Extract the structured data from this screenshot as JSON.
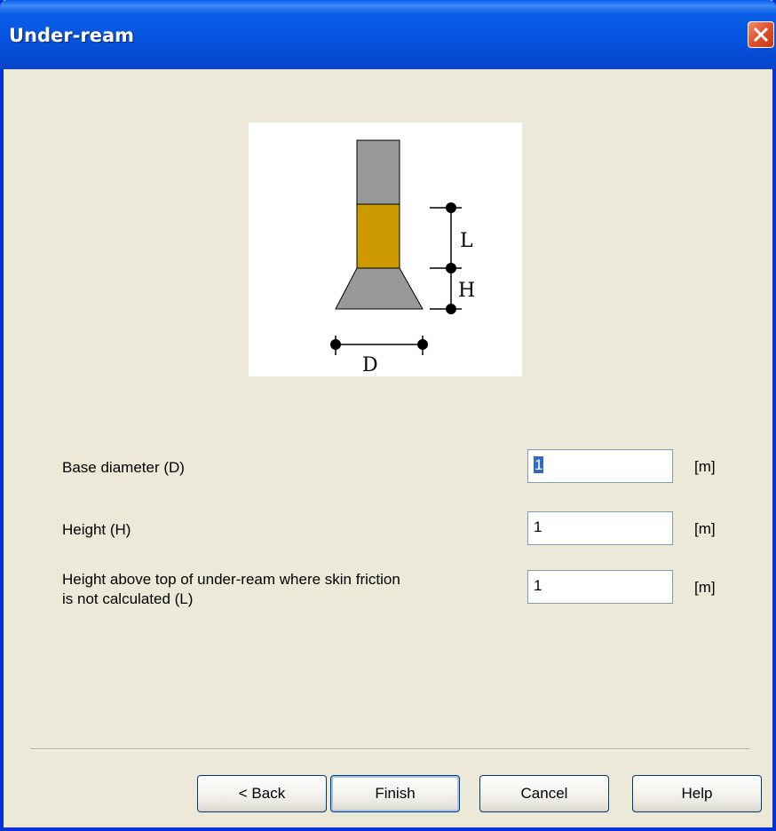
{
  "window": {
    "title": "Under-ream"
  },
  "diagram": {
    "labels": {
      "L": "L",
      "H": "H",
      "D": "D"
    },
    "colors": {
      "shaft": "#999999",
      "friction_zone": "#cc9900",
      "base": "#999999"
    }
  },
  "fields": [
    {
      "label": "Base diameter (D)",
      "value": "1",
      "unit": "[m]"
    },
    {
      "label": "Height (H)",
      "value": "1",
      "unit": "[m]"
    },
    {
      "label_line1": "Height above top of under-ream where skin friction",
      "label_line2": "is not calculated (L)",
      "value": "1",
      "unit": "[m]"
    }
  ],
  "buttons": {
    "back": "< Back",
    "finish": "Finish",
    "cancel": "Cancel",
    "help": "Help"
  }
}
